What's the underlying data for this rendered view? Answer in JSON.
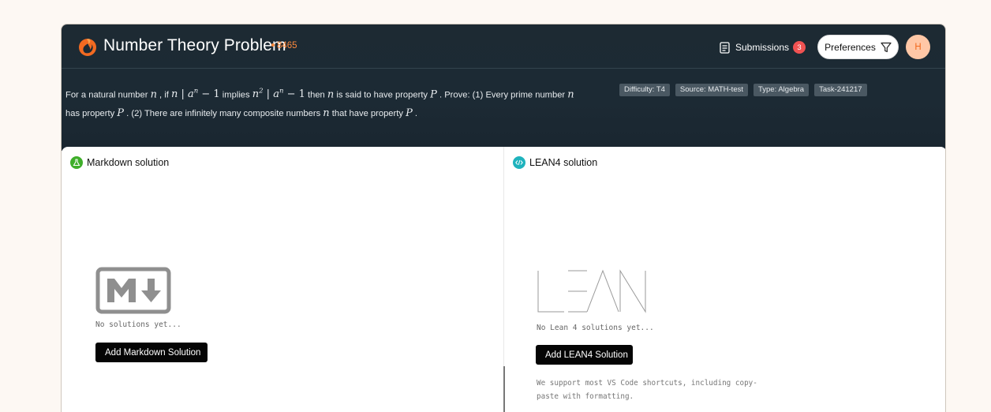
{
  "header": {
    "title": "Number Theory Problem",
    "problem_id": "8465",
    "submissions_label": "Submissions",
    "submissions_count": "3",
    "preferences_label": "Preferences",
    "avatar_initial": "H"
  },
  "statement": {
    "t1": "For a natural number ",
    "t2": " , if ",
    "t3": " implies ",
    "t4": " then ",
    "t5": " is said to have property ",
    "t6": " . Prove: (1) Every prime number ",
    "t7": "has property ",
    "t8": " . (2) There are infinitely many composite numbers ",
    "t9": " that have property ",
    "t10": " .",
    "var_n": "n",
    "var_a": "a",
    "var_p": "P",
    "exp_n": "n",
    "exp_2": "2",
    "minus_one": " − 1",
    "divides": " | "
  },
  "tags": [
    "Difficulty: T4",
    "Source: MATH-test",
    "Type: Algebra",
    "Task-241217"
  ],
  "markdown_panel": {
    "title": "Markdown solution",
    "empty_text": "No solutions yet...",
    "button_label": "Add Markdown Solution"
  },
  "lean_panel": {
    "title": "LEAN4 solution",
    "empty_text": "No Lean 4 solutions yet...",
    "button_label": "Add LEAN4 Solution",
    "note": "We support most VS Code shortcuts, including copy-paste with formatting."
  },
  "colors": {
    "header_bg": "#1d2a33",
    "accent_orange": "#ff8a3d",
    "badge_red": "#f05252",
    "markdown_icon": "#3fae2a",
    "lean_icon": "#1fb3bd"
  }
}
